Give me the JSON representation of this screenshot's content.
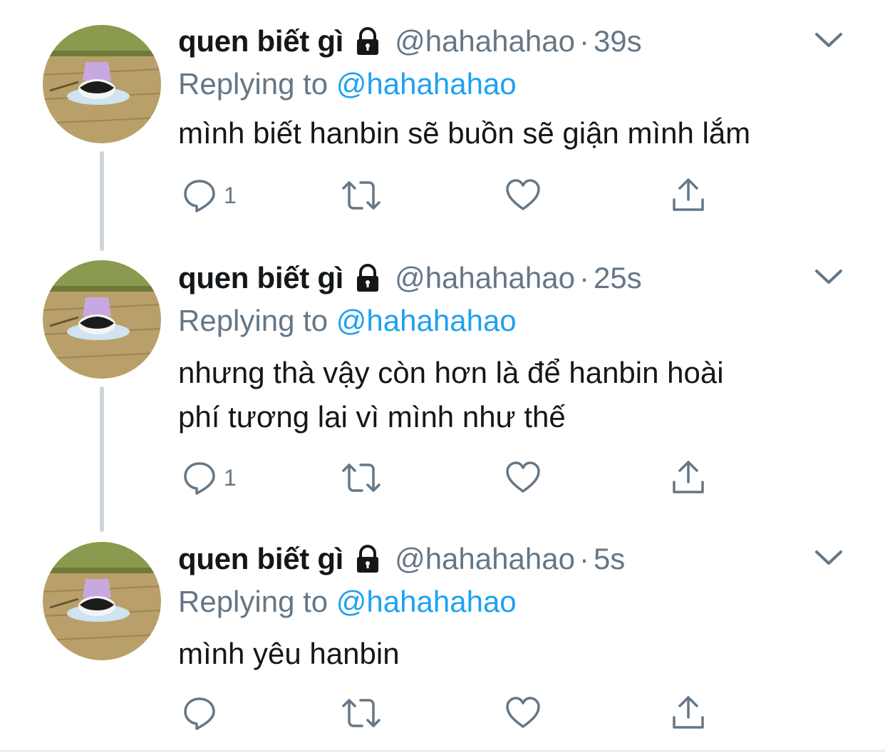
{
  "tweets": [
    {
      "display_name": "quen biết gì",
      "handle": "@hahahahao",
      "separator": "·",
      "time": "39s",
      "replying_label": "Replying to",
      "replying_handle": "@hahahahao",
      "text_lines": [
        "mình biết hanbin sẽ buồn sẽ giận mình lắm"
      ],
      "reply_count": "1",
      "icons": {
        "reply": "reply-icon",
        "retweet": "retweet-icon",
        "like": "heart-icon",
        "share": "share-icon",
        "menu": "chevron-down-icon",
        "lock": "lock-icon"
      }
    },
    {
      "display_name": "quen biết gì",
      "handle": "@hahahahao",
      "separator": "·",
      "time": "25s",
      "replying_label": "Replying to",
      "replying_handle": "@hahahahao",
      "text_lines": [
        "nhưng thà vậy còn hơn là để hanbin hoài",
        "phí tương lai vì mình như thế"
      ],
      "reply_count": "1",
      "icons": {
        "reply": "reply-icon",
        "retweet": "retweet-icon",
        "like": "heart-icon",
        "share": "share-icon",
        "menu": "chevron-down-icon",
        "lock": "lock-icon"
      }
    },
    {
      "display_name": "quen biết gì",
      "handle": "@hahahahao",
      "separator": "·",
      "time": "5s",
      "replying_label": "Replying to",
      "replying_handle": "@hahahahao",
      "text_lines": [
        "mình yêu hanbin"
      ],
      "reply_count": "",
      "icons": {
        "reply": "reply-icon",
        "retweet": "retweet-icon",
        "like": "heart-icon",
        "share": "share-icon",
        "menu": "chevron-down-icon",
        "lock": "lock-icon"
      }
    }
  ],
  "colors": {
    "text": "#14171a",
    "secondary": "#657786",
    "link": "#1da1f2",
    "thread_line": "#ccd6dd",
    "divider": "#e1e8ed"
  }
}
